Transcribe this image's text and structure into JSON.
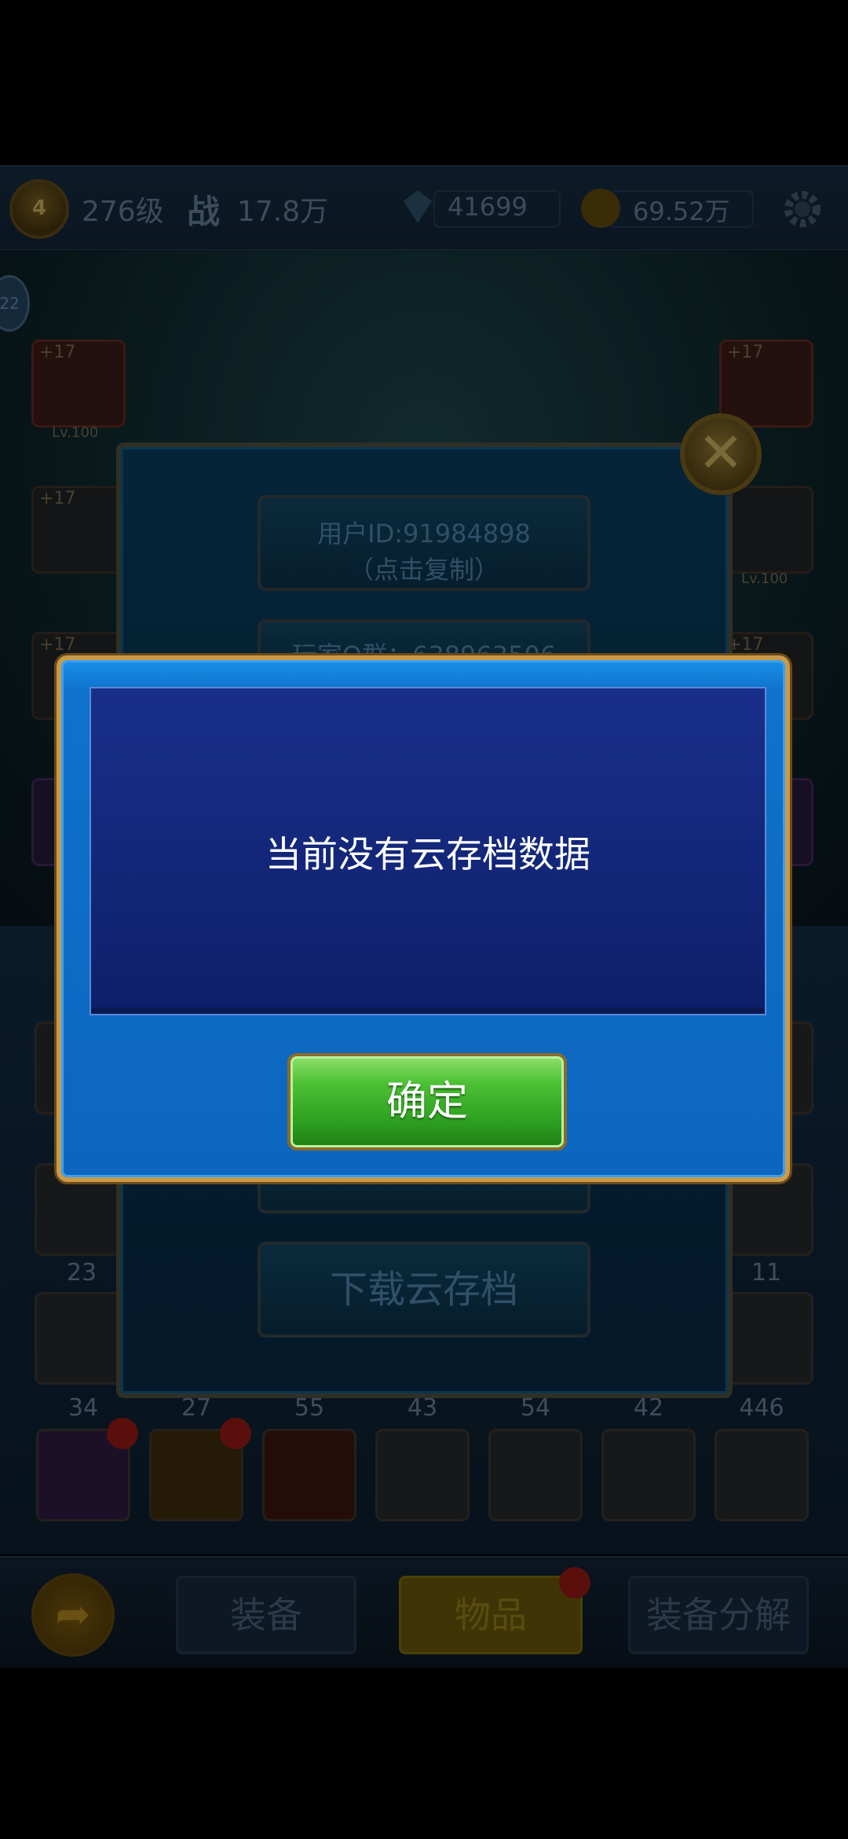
{
  "topbar": {
    "rank_badge": "4",
    "level": "276级",
    "power_label": "战",
    "power_value": "17.8万",
    "gems": "41699",
    "gold": "69.52万",
    "settings_icon": "gear-icon"
  },
  "left_badge": "22",
  "slot_levels": [
    "+17",
    "+17",
    "+17",
    "+17",
    "+17"
  ],
  "slot_captions": [
    "Lv.100",
    "Lv.100"
  ],
  "item_counts_row1": [
    "23",
    "11"
  ],
  "item_counts_row2": [
    "34",
    "27",
    "55",
    "43",
    "54",
    "42",
    "446"
  ],
  "bottom_tabs": [
    "装备",
    "物品",
    "装备分解"
  ],
  "panel": {
    "user_id_line1": "用户ID:91984898",
    "user_id_line2": "（点击复制）",
    "player_group": "玩家Q群：638963506",
    "download_button": "下载云存档",
    "close_icon": "close-icon"
  },
  "dialog": {
    "message": "当前没有云存档数据",
    "confirm_button": "确定"
  }
}
